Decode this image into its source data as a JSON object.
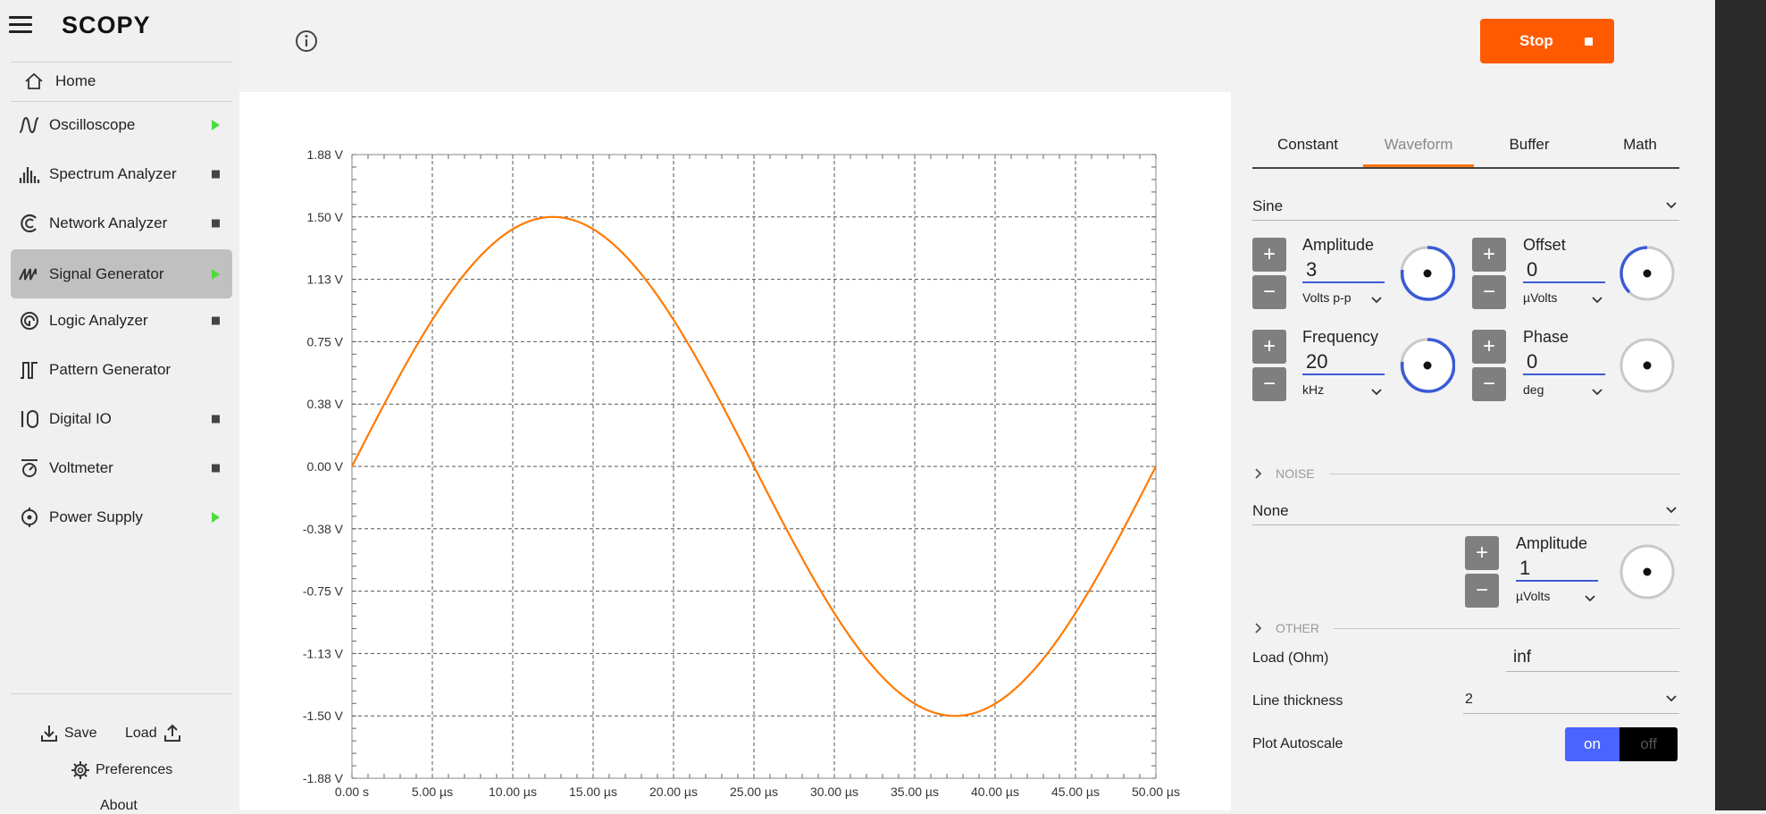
{
  "app": {
    "logo": "SCOPY"
  },
  "sidebar": {
    "home_label": "Home",
    "items": [
      {
        "label": "Oscilloscope",
        "icon": "oscilloscope-icon",
        "status": "running"
      },
      {
        "label": "Spectrum Analyzer",
        "icon": "spectrum-analyzer-icon",
        "status": "stopped"
      },
      {
        "label": "Network Analyzer",
        "icon": "network-analyzer-icon",
        "status": "stopped"
      },
      {
        "label": "Signal Generator",
        "icon": "signal-generator-icon",
        "status": "running",
        "active": true
      },
      {
        "label": "Logic Analyzer",
        "icon": "logic-analyzer-icon",
        "status": "stopped"
      },
      {
        "label": "Pattern Generator",
        "icon": "pattern-generator-icon",
        "status": "none"
      },
      {
        "label": "Digital IO",
        "icon": "digital-io-icon",
        "status": "stopped"
      },
      {
        "label": "Voltmeter",
        "icon": "voltmeter-icon",
        "status": "stopped"
      },
      {
        "label": "Power Supply",
        "icon": "power-supply-icon",
        "status": "running"
      }
    ],
    "save_label": "Save",
    "load_label": "Load",
    "preferences_label": "Preferences",
    "about_label": "About"
  },
  "toolbar": {
    "stop_label": "Stop"
  },
  "colors": {
    "accent": "#ff5a00",
    "trace": "#ff7a00",
    "running": "#4cdb3f",
    "knob_active": "#3a5bd6",
    "toggle_on": "#4a64ff"
  },
  "chart_data": {
    "type": "line",
    "title": "",
    "xlabel": "",
    "ylabel": "",
    "y_tick_labels": [
      "1.88 V",
      "1.50 V",
      "1.13 V",
      "0.75 V",
      "0.38 V",
      "0.00 V",
      "-0.38 V",
      "-0.75 V",
      "-1.13 V",
      "-1.50 V",
      "-1.88 V"
    ],
    "x_tick_labels": [
      "0.00 s",
      "5.00 µs",
      "10.00 µs",
      "15.00 µs",
      "20.00 µs",
      "25.00 µs",
      "30.00 µs",
      "35.00 µs",
      "40.00 µs",
      "45.00 µs",
      "50.00 µs"
    ],
    "xlim_us": [
      0,
      50
    ],
    "ylim_v": [
      -1.875,
      1.875
    ],
    "grid": true,
    "series": [
      {
        "waveform": "sine",
        "amplitude_v": 1.5,
        "frequency_khz": 20,
        "offset_v": 0,
        "phase_deg": 0,
        "color": "#ff7a00"
      }
    ]
  },
  "panel": {
    "tabs": [
      "Constant",
      "Waveform",
      "Buffer",
      "Math"
    ],
    "active_tab": "Waveform",
    "waveform_type": "Sine",
    "amplitude": {
      "label": "Amplitude",
      "value": "3",
      "unit": "Volts p-p"
    },
    "offset": {
      "label": "Offset",
      "value": "0",
      "unit": "µVolts"
    },
    "frequency": {
      "label": "Frequency",
      "value": "20",
      "unit": "kHz"
    },
    "phase": {
      "label": "Phase",
      "value": "0",
      "unit": "deg"
    },
    "noise": {
      "header": "NOISE",
      "type": "None",
      "amplitude": {
        "label": "Amplitude",
        "value": "1",
        "unit": "µVolts"
      }
    },
    "other": {
      "header": "OTHER",
      "load_label": "Load (Ohm)",
      "load_value": "inf",
      "line_thickness_label": "Line thickness",
      "line_thickness_value": "2",
      "autoscale_label": "Plot Autoscale",
      "autoscale_on": "on",
      "autoscale_off": "off"
    },
    "plus": "+",
    "minus": "−"
  }
}
